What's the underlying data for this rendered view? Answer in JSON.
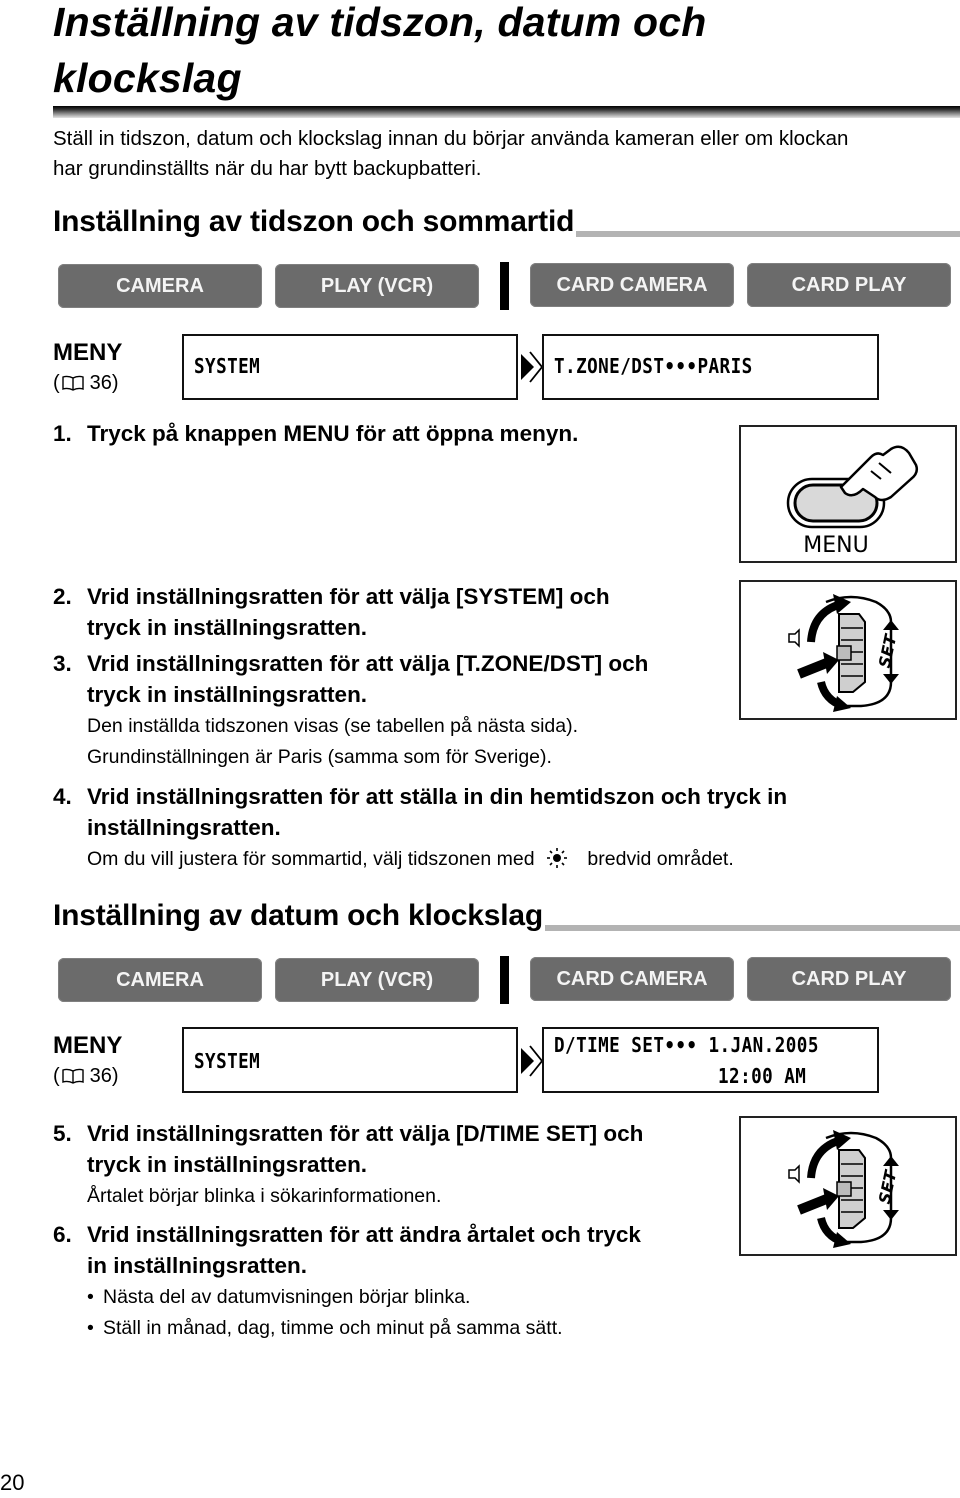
{
  "page": {
    "title": "Inställning av tidszon, datum och klockslag",
    "title_line1": "Inställning av tidszon, datum och",
    "title_line2": "klockslag",
    "intro_line1": "Ställ in tidszon, datum och klockslag innan du börjar använda kameran eller om klockan",
    "intro_line2": "har grundinställts när du har bytt backupbatteri.",
    "page_number": "20"
  },
  "sections": [
    {
      "title": "Inställning av tidszon och sommartid",
      "modes": [
        {
          "label": "CAMERA",
          "icon": "none"
        },
        {
          "label": "PLAY (VCR)",
          "icon": "none"
        },
        {
          "label": "CARD CAMERA",
          "icon": "none"
        },
        {
          "label": "CARD PLAY",
          "icon": "none"
        }
      ],
      "menu": {
        "label": "MENY",
        "ref_prefix": "(",
        "ref_icon": "book-icon",
        "ref_page": "36)",
        "box1": "SYSTEM",
        "arrow_icon": "double-chevron-right-icon",
        "box2_line1": "T.ZONE/DST•••PARIS"
      },
      "steps": [
        {
          "num": "1.",
          "text": "Tryck på knappen MENU för att öppna menyn."
        },
        {
          "num": "2.",
          "line1": "Vrid inställningsratten för att välja [SYSTEM] och",
          "line2": "tryck in inställningsratten."
        },
        {
          "num": "3.",
          "line1": "Vrid inställningsratten för att välja [T.ZONE/DST] och",
          "line2": "tryck in inställningsratten.",
          "notes": [
            "Den inställda tidszonen visas (se tabellen på nästa sida).",
            "Grundinställningen är Paris (samma som för Sverige)."
          ]
        },
        {
          "num": "4.",
          "line1": "Vrid inställningsratten för att ställa in din hemtidszon och tryck in",
          "line2": "inställningsratten.",
          "note_before": "Om du vill justera för sommartid, välj tidszonen med",
          "note_icon": "sun-icon",
          "note_after": "bredvid området."
        }
      ],
      "figures": [
        {
          "name": "menu-button-illustration",
          "label": "MENU"
        },
        {
          "name": "set-dial-illustration",
          "label": "SET"
        }
      ]
    },
    {
      "title": "Inställning av datum och klockslag",
      "modes": [
        {
          "label": "CAMERA"
        },
        {
          "label": "PLAY (VCR)"
        },
        {
          "label": "CARD CAMERA"
        },
        {
          "label": "CARD PLAY"
        }
      ],
      "menu": {
        "label": "MENY",
        "ref_prefix": "(",
        "ref_page": "36)",
        "box1": "SYSTEM",
        "box2_line1": "D/TIME SET••• 1.JAN.2005",
        "box2_line2": "12:00 AM"
      },
      "steps": [
        {
          "num": "5.",
          "line1": "Vrid inställningsratten för att välja [D/TIME SET] och",
          "line2": "tryck in inställningsratten.",
          "notes": [
            "Årtalet börjar blinka i sökarinformationen."
          ]
        },
        {
          "num": "6.",
          "line1": "Vrid inställningsratten för att ändra årtalet och tryck",
          "line2": "in inställningsratten.",
          "bullets": [
            "Nästa del av datumvisningen börjar blinka.",
            "Ställ in månad, dag, timme och minut på samma sätt."
          ]
        }
      ],
      "figures": [
        {
          "name": "set-dial-illustration",
          "label": "SET"
        }
      ]
    }
  ]
}
